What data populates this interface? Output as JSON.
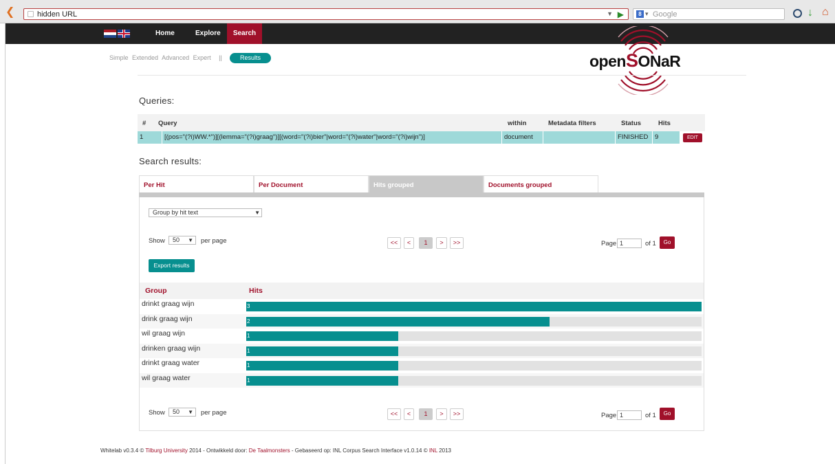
{
  "browser": {
    "url": "hidden URL",
    "search_placeholder": "Google"
  },
  "nav": {
    "home": "Home",
    "explore": "Explore",
    "search": "Search"
  },
  "subnav": {
    "items": [
      "Simple",
      "Extended",
      "Advanced",
      "Expert"
    ],
    "separator": "||",
    "results": "Results"
  },
  "logo": {
    "part1": "open",
    "part2": "S",
    "part3": "ONaR"
  },
  "queries": {
    "heading": "Queries:",
    "columns": [
      "#",
      "Query",
      "within",
      "Metadata filters",
      "Status",
      "Hits"
    ],
    "row": {
      "num": "1",
      "query": "[(pos=\"(?i)WW.*\")][(lemma=\"(?i)graag\")][(word=\"(?i)bier\"|word=\"(?i)water\"|word=\"(?i)wijn\")]",
      "within": "document",
      "filters": "",
      "status": "FINISHED",
      "hits": "9"
    },
    "edit_label": "EDIT"
  },
  "results": {
    "heading": "Search results:",
    "tabs": [
      "Per Hit",
      "Per Document",
      "Hits grouped",
      "Documents grouped"
    ],
    "group_by": "Group by hit text",
    "show_label": "Show",
    "per_page_value": "50",
    "per_page_label": "per page",
    "pager": [
      "<<",
      "<",
      "1",
      ">",
      ">>"
    ],
    "page_label": "Page",
    "page_value": "1",
    "of_label": "of 1",
    "go_label": "Go",
    "export_label": "Export results",
    "col_group": "Group",
    "col_hits": "Hits",
    "max_hits": 3,
    "groups": [
      {
        "label": "drinkt graag wijn",
        "hits": 3
      },
      {
        "label": "drink graag wijn",
        "hits": 2
      },
      {
        "label": "wil graag wijn",
        "hits": 1
      },
      {
        "label": "drinken graag wijn",
        "hits": 1
      },
      {
        "label": "drinkt graag water",
        "hits": 1
      },
      {
        "label": "wil graag water",
        "hits": 1
      }
    ]
  },
  "footer": {
    "t1": "Whitelab v0.3.4 © ",
    "l1": "Tilburg University",
    "t2": " 2014 - Ontwikkeld door: ",
    "l2": "De Taalmonsters",
    "t3": " - Gebaseerd op: INL Corpus Search Interface v1.0.14 © ",
    "l3": "INL",
    "t4": " 2013"
  },
  "colors": {
    "brand_red": "#a0102a",
    "teal": "#078f8f"
  }
}
